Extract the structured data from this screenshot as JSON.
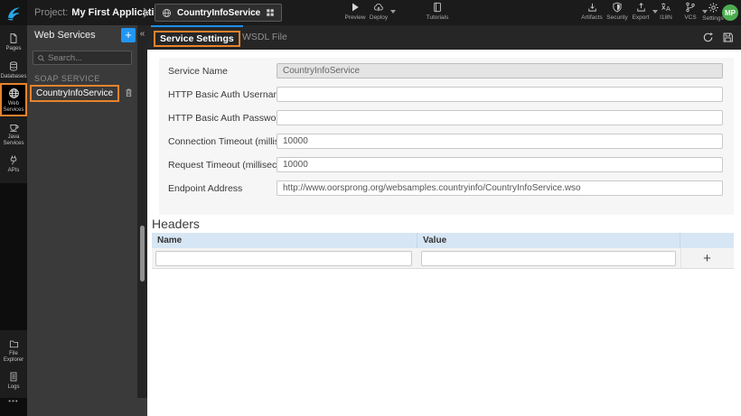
{
  "topbar": {
    "project_label": "Project:",
    "project_name": "My First Application",
    "service_tab_name": "CountryInfoService",
    "actions_left": [
      {
        "label": "Preview"
      },
      {
        "label": "Deploy"
      },
      {
        "label": "Tutorials"
      }
    ],
    "actions_right": [
      {
        "label": "Artifacts"
      },
      {
        "label": "Security"
      },
      {
        "label": "Export"
      },
      {
        "label": "I18N"
      },
      {
        "label": "VCS"
      },
      {
        "label": "Settings"
      }
    ],
    "avatar_initials": "MP"
  },
  "sidebar": {
    "items_top": [
      {
        "label": "Pages"
      },
      {
        "label": "Databases"
      },
      {
        "label": "Web Services"
      },
      {
        "label": "Java Services"
      },
      {
        "label": "APIs"
      }
    ],
    "items_bottom": [
      {
        "label": "File Explorer"
      },
      {
        "label": "Logs"
      }
    ],
    "more_label": "•••",
    "selected_item": "Web Services"
  },
  "panel": {
    "title": "Web Services",
    "add_button": "+",
    "collapse_icon": "«",
    "search_placeholder": "Search...",
    "section_label": "SOAP SERVICE",
    "items": [
      {
        "name": "CountryInfoService"
      }
    ]
  },
  "main": {
    "tabs": [
      {
        "label": "Service Settings",
        "active": true
      },
      {
        "label": "WSDL File",
        "active": false
      }
    ],
    "form": {
      "fields": [
        {
          "label": "Service Name",
          "value": "CountryInfoService",
          "disabled": true
        },
        {
          "label": "HTTP Basic Auth Username",
          "value": ""
        },
        {
          "label": "HTTP Basic Auth Password",
          "value": ""
        },
        {
          "label": "Connection Timeout (milliseconds)",
          "value": "10000"
        },
        {
          "label": "Request Timeout (milliseconds)",
          "value": "10000"
        },
        {
          "label": "Endpoint Address",
          "value": "http://www.oorsprong.org/websamples.countryinfo/CountryInfoService.wso"
        }
      ]
    },
    "headers_section": {
      "title": "Headers",
      "columns": [
        "Name",
        "Value"
      ],
      "add_button": "+",
      "rows": [
        {
          "name": "",
          "value": ""
        }
      ]
    }
  },
  "icons": {
    "logo": "wavemaker-swoosh",
    "preview": "play-triangle",
    "deploy": "cloud-upload",
    "tutorials": "book",
    "artifacts": "tray-download",
    "security": "shield",
    "export": "tray-upload",
    "i18n": "translate",
    "vcs": "branch",
    "settings": "gear",
    "service_tab": "globe + grid",
    "panel_item_action": "trash",
    "tabbar": "refresh + save"
  },
  "colors": {
    "accent_blue": "#2196f3",
    "highlight_orange": "#e8832c",
    "tab_indicator_blue": "#1e8fe8",
    "avatar_green": "#4cae50",
    "table_header_bg": "#d7e6f4",
    "topbar_bg": "#1b1b1b",
    "panel_bg": "#3a3a3a",
    "card_bg": "#f6f6f6"
  }
}
